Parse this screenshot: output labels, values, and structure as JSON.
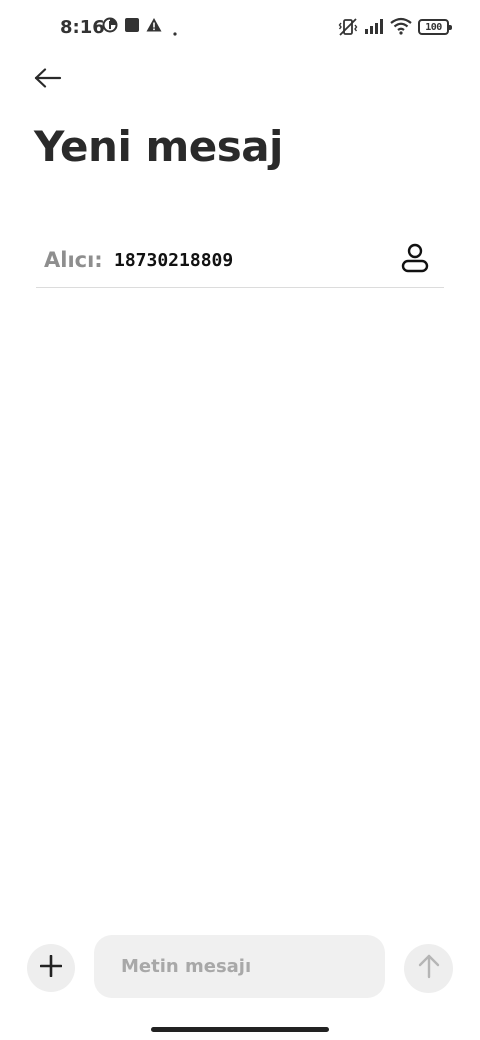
{
  "status_bar": {
    "time": "8:16",
    "battery": "100",
    "icons": [
      "data-saver-icon",
      "square-notification-icon",
      "warning-icon",
      "dot-icon",
      "vibrate-off-icon",
      "signal-icon",
      "wifi-icon",
      "battery-icon"
    ]
  },
  "header": {
    "back_icon": "arrow-left-icon",
    "title": "Yeni mesaj"
  },
  "recipient": {
    "label": "Alıcı:",
    "value": "18730218809",
    "contact_icon": "person-icon"
  },
  "composer": {
    "add_icon": "plus-icon",
    "placeholder": "Metin mesajı",
    "value": "",
    "send_icon": "arrow-up-icon"
  },
  "colors": {
    "background": "#ffffff",
    "title": "#2a2a2a",
    "label_gray": "#8e8e8e",
    "input_bg": "#f0f0f0",
    "button_bg": "#eeeeee"
  }
}
